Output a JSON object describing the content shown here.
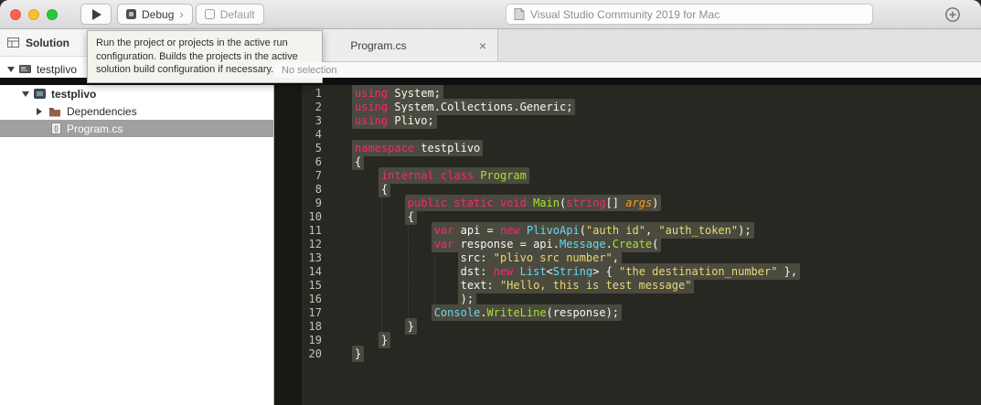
{
  "window": {
    "title": "Visual Studio Community 2019 for Mac",
    "traffic_lights": {
      "close": "#ff5f57",
      "minimize": "#febc2e",
      "zoom": "#28c840"
    }
  },
  "toolbar": {
    "run_tooltip": "Run the project or projects in the active run configuration. Builds the projects in the active solution build configuration if necessary.",
    "debug_label": "Debug",
    "debug_chevron": "›",
    "default_label": "Default"
  },
  "sidebar": {
    "header": "Solution",
    "items": [
      {
        "label": "testplivo",
        "type": "solution",
        "expander": "down",
        "bold": false,
        "selected": false
      },
      {
        "label": "testplivo",
        "type": "project",
        "expander": "down",
        "bold": true,
        "selected": false
      },
      {
        "label": "Dependencies",
        "type": "dependencies-folder",
        "expander": "right",
        "bold": false,
        "selected": false
      },
      {
        "label": "Program.cs",
        "type": "csharp-file",
        "expander": "none",
        "bold": false,
        "selected": true
      }
    ]
  },
  "editor": {
    "tab_label": "Program.cs",
    "tab_close": "×",
    "breadcrumb": "No selection",
    "colors": {
      "kw": "#f92672",
      "pl": "#f8f8f2",
      "str": "#e6db74",
      "cy": "#66d9ef",
      "gr": "#a6e22e",
      "or": "#fd971f",
      "hl": "#4b4a3f",
      "bg": "#272822",
      "gutter": "#181814",
      "line_number": "#c2c2b8"
    },
    "lines": [
      {
        "n": 1,
        "indent": 0,
        "seg": [
          [
            "using",
            "kw"
          ],
          [
            " System;",
            "pl"
          ]
        ]
      },
      {
        "n": 2,
        "indent": 0,
        "seg": [
          [
            "using",
            "kw"
          ],
          [
            " System.Collections.Generic;",
            "pl"
          ]
        ]
      },
      {
        "n": 3,
        "indent": 0,
        "seg": [
          [
            "using",
            "kw"
          ],
          [
            " Plivo;",
            "pl"
          ]
        ]
      },
      {
        "n": 4,
        "indent": 0,
        "seg": []
      },
      {
        "n": 5,
        "indent": 0,
        "seg": [
          [
            "namespace",
            "kw"
          ],
          [
            " testplivo",
            "pl"
          ]
        ]
      },
      {
        "n": 6,
        "indent": 0,
        "seg": [
          [
            "{",
            "pl"
          ]
        ]
      },
      {
        "n": 7,
        "indent": 4,
        "seg": [
          [
            "internal class ",
            "kw"
          ],
          [
            "Program",
            "gr"
          ]
        ]
      },
      {
        "n": 8,
        "indent": 4,
        "seg": [
          [
            "{",
            "pl"
          ]
        ]
      },
      {
        "n": 9,
        "indent": 8,
        "seg": [
          [
            "public static void ",
            "kw"
          ],
          [
            "Main",
            "gr"
          ],
          [
            "(",
            "pl"
          ],
          [
            "string",
            "kw"
          ],
          [
            "[] ",
            "pl"
          ],
          [
            "args",
            "or"
          ],
          [
            ")",
            "pl"
          ]
        ]
      },
      {
        "n": 10,
        "indent": 8,
        "seg": [
          [
            "{",
            "pl"
          ]
        ]
      },
      {
        "n": 11,
        "indent": 12,
        "seg": [
          [
            "var",
            "kw"
          ],
          [
            " api = ",
            "pl"
          ],
          [
            "new",
            "kw"
          ],
          [
            " ",
            "pl"
          ],
          [
            "PlivoApi",
            "cy"
          ],
          [
            "(",
            "pl"
          ],
          [
            "\"auth_id\"",
            "str"
          ],
          [
            ", ",
            "pl"
          ],
          [
            "\"auth_token\"",
            "str"
          ],
          [
            ");",
            "pl"
          ]
        ]
      },
      {
        "n": 12,
        "indent": 12,
        "seg": [
          [
            "var",
            "kw"
          ],
          [
            " response = api.",
            "pl"
          ],
          [
            "Message",
            "cy"
          ],
          [
            ".",
            "pl"
          ],
          [
            "Create",
            "gr"
          ],
          [
            "(",
            "pl"
          ]
        ]
      },
      {
        "n": 13,
        "indent": 16,
        "seg": [
          [
            "src: ",
            "pl"
          ],
          [
            "\"plivo_src_number\"",
            "str"
          ],
          [
            ",",
            "pl"
          ]
        ]
      },
      {
        "n": 14,
        "indent": 16,
        "seg": [
          [
            "dst: ",
            "pl"
          ],
          [
            "new",
            "kw"
          ],
          [
            " ",
            "pl"
          ],
          [
            "List",
            "cy"
          ],
          [
            "<",
            "pl"
          ],
          [
            "String",
            "cy"
          ],
          [
            "> { ",
            "pl"
          ],
          [
            "\"the_destination_number\"",
            "str"
          ],
          [
            " },",
            "pl"
          ]
        ]
      },
      {
        "n": 15,
        "indent": 16,
        "seg": [
          [
            "text: ",
            "pl"
          ],
          [
            "\"Hello, this is test message\"",
            "str"
          ]
        ]
      },
      {
        "n": 16,
        "indent": 16,
        "seg": [
          [
            ");",
            "pl"
          ]
        ]
      },
      {
        "n": 17,
        "indent": 12,
        "seg": [
          [
            "Console",
            "cy"
          ],
          [
            ".",
            "pl"
          ],
          [
            "WriteLine",
            "gr"
          ],
          [
            "(response);",
            "pl"
          ]
        ]
      },
      {
        "n": 18,
        "indent": 8,
        "seg": [
          [
            "}",
            "pl"
          ]
        ]
      },
      {
        "n": 19,
        "indent": 4,
        "seg": [
          [
            "}",
            "pl"
          ]
        ]
      },
      {
        "n": 20,
        "indent": 0,
        "seg": [
          [
            "}",
            "pl"
          ]
        ]
      }
    ]
  }
}
